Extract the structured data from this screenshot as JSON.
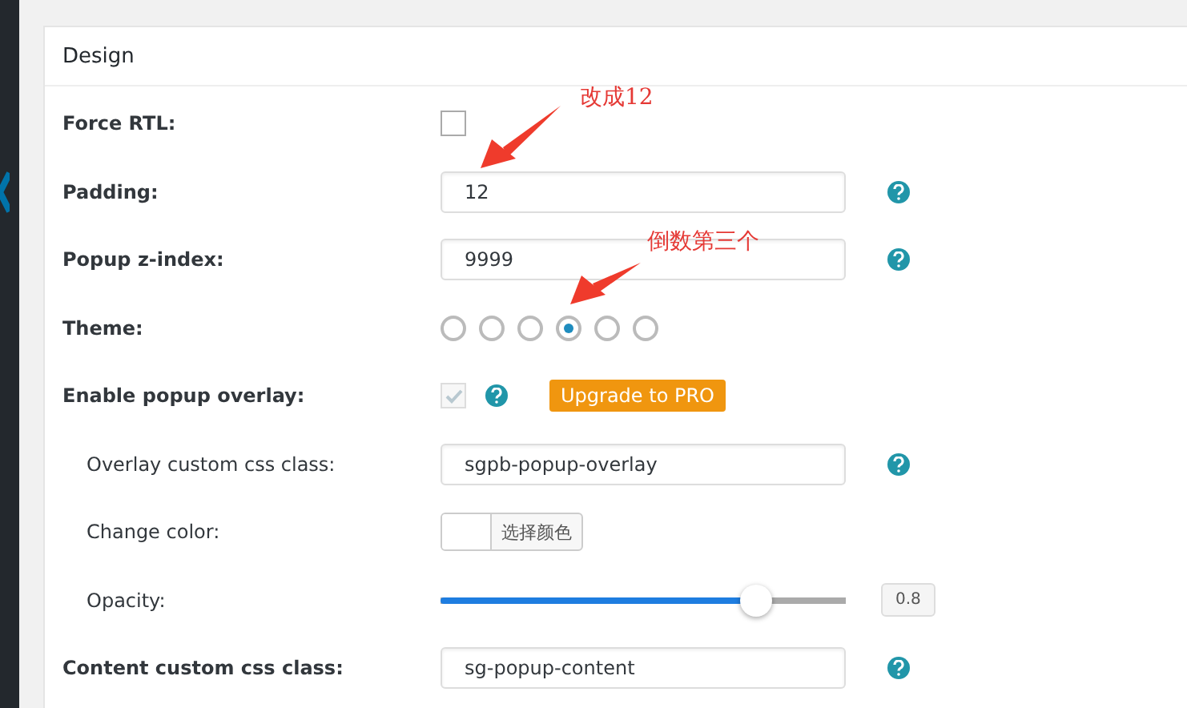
{
  "panel": {
    "title": "Design"
  },
  "rows": [
    {
      "kind": "checkbox",
      "label": "Force RTL:",
      "bold": true,
      "checked": false,
      "disabled": false
    },
    {
      "kind": "input",
      "label": "Padding:",
      "bold": true,
      "value": "12",
      "help": true
    },
    {
      "kind": "input",
      "label": "Popup z-index:",
      "bold": true,
      "value": "9999",
      "help": true
    },
    {
      "kind": "radio",
      "label": "Theme:",
      "bold": true,
      "options": [
        {
          "selected": false
        },
        {
          "selected": false
        },
        {
          "selected": false
        },
        {
          "selected": true
        },
        {
          "selected": false
        },
        {
          "selected": false
        }
      ]
    },
    {
      "kind": "checkbox",
      "label": "Enable popup overlay:",
      "bold": true,
      "checked": true,
      "disabled": true,
      "help": true,
      "badge": "Upgrade to PRO"
    },
    {
      "kind": "input",
      "label": "Overlay custom css class:",
      "bold": false,
      "value": "sgpb-popup-overlay",
      "help": true
    },
    {
      "kind": "color",
      "label": "Change color:",
      "bold": false,
      "button": "选择颜色"
    },
    {
      "kind": "slider",
      "label": "Opacity:",
      "bold": false,
      "level": 0.78,
      "reading": "0.8"
    },
    {
      "kind": "input",
      "label": "Content custom css class:",
      "bold": true,
      "value": "sg-popup-content",
      "help": true
    }
  ],
  "annotations": [
    {
      "text": "改成12"
    },
    {
      "text": "倒数第三个"
    }
  ]
}
